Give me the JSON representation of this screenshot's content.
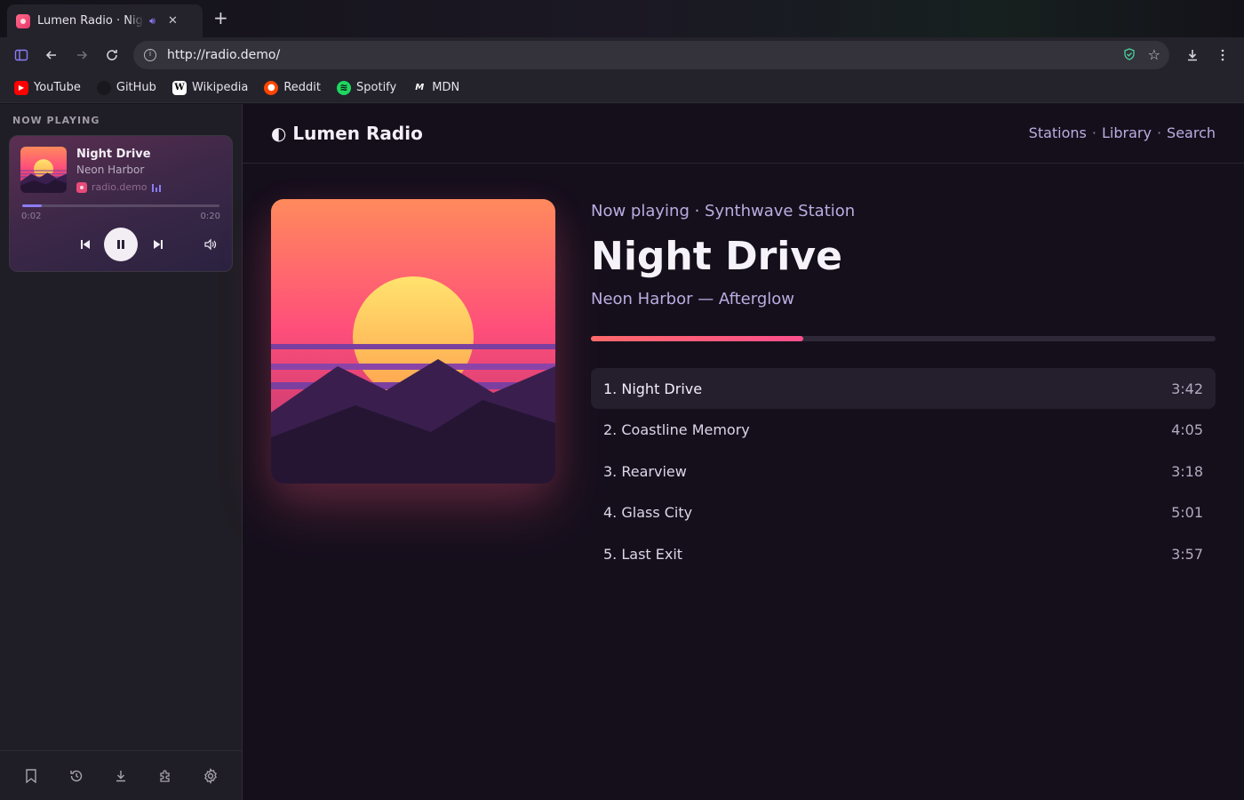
{
  "browser": {
    "tab_title": "Lumen Radio · Night Drive",
    "url": "http://radio.demo/",
    "bookmarks": [
      {
        "label": "YouTube",
        "icon": "youtube-icon",
        "color": "#ff0000"
      },
      {
        "label": "GitHub",
        "icon": "github-icon",
        "color": "#24222b"
      },
      {
        "label": "Wikipedia",
        "icon": "wikipedia-icon",
        "color": "#ffffff"
      },
      {
        "label": "Reddit",
        "icon": "reddit-icon",
        "color": "#ff4500"
      },
      {
        "label": "Spotify",
        "icon": "spotify-icon",
        "color": "#1ed760"
      },
      {
        "label": "MDN",
        "icon": "mdn-icon",
        "color": "#ffffff"
      }
    ]
  },
  "sidebar": {
    "section_label": "NOW PLAYING",
    "mini_player": {
      "title": "Night Drive",
      "artist": "Neon Harbor",
      "source": "radio.demo",
      "elapsed": "0:02",
      "duration": "0:20",
      "progress": 0.1
    }
  },
  "main": {
    "logo_glyph": "◐",
    "logo_text": "Lumen Radio",
    "nav": [
      "Stations",
      "Library",
      "Search"
    ],
    "nav_separator": "·",
    "now_playing_subtitle": "Now playing · Synthwave Station",
    "title": "Night Drive",
    "artist_album": "Neon Harbor — Afterglow",
    "progress": 0.34,
    "tracks": [
      {
        "label": "1. Night Drive",
        "duration": "3:42",
        "active": true
      },
      {
        "label": "2. Coastline Memory",
        "duration": "4:05",
        "active": false
      },
      {
        "label": "3. Rearview",
        "duration": "3:18",
        "active": false
      },
      {
        "label": "4. Glass City",
        "duration": "5:01",
        "active": false
      },
      {
        "label": "5. Last Exit",
        "duration": "3:57",
        "active": false
      }
    ]
  },
  "colors": {
    "accent": "#8b7cf6",
    "progress_gradient_start": "#ff6a6a",
    "progress_gradient_end": "#ff4f8c"
  }
}
